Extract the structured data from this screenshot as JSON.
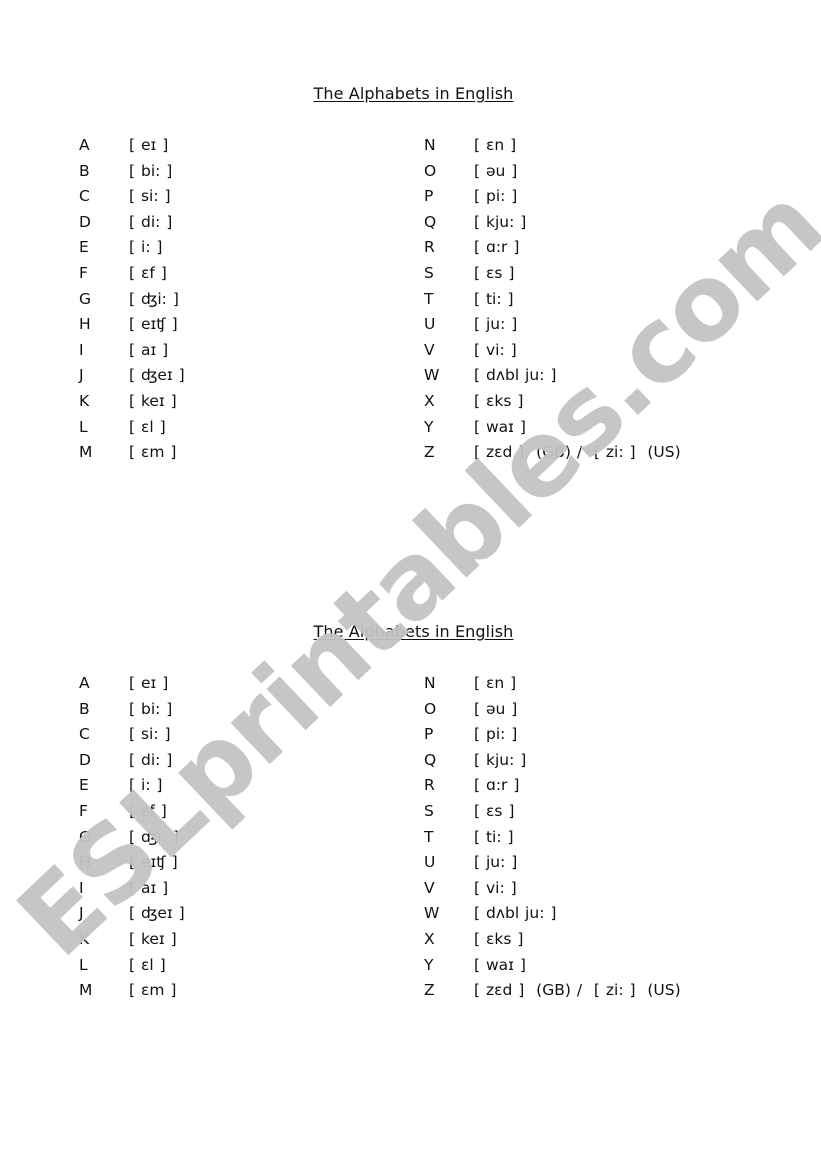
{
  "watermark": "ESLprintables.com",
  "blocks": [
    {
      "title": "The Alphabets in English",
      "left": [
        {
          "letter": "A",
          "ipa": "[ eɪ ]"
        },
        {
          "letter": "B",
          "ipa": "[ bi: ]"
        },
        {
          "letter": "C",
          "ipa": "[ si: ]"
        },
        {
          "letter": "D",
          "ipa": "[ di: ]"
        },
        {
          "letter": "E",
          "ipa": "[ i: ]"
        },
        {
          "letter": "F",
          "ipa": "[ ɛf ]"
        },
        {
          "letter": "G",
          "ipa": "[ ʤi: ]"
        },
        {
          "letter": "H",
          "ipa": "[ eɪʧ ]"
        },
        {
          "letter": "I",
          "ipa": "[ aɪ ]"
        },
        {
          "letter": "J",
          "ipa": "[ ʤeɪ ]"
        },
        {
          "letter": "K",
          "ipa": "[ keɪ ]"
        },
        {
          "letter": "L",
          "ipa": "[ ɛl ]"
        },
        {
          "letter": "M",
          "ipa": "[ ɛm ]"
        }
      ],
      "right": [
        {
          "letter": "N",
          "ipa": "[ ɛn ]"
        },
        {
          "letter": "O",
          "ipa": "[ əu ]"
        },
        {
          "letter": "P",
          "ipa": "[ pi: ]"
        },
        {
          "letter": "Q",
          "ipa": "[ kju: ]"
        },
        {
          "letter": "R",
          "ipa": "[ ɑ:r ]"
        },
        {
          "letter": "S",
          "ipa": "[ ɛs ]"
        },
        {
          "letter": "T",
          "ipa": "[ ti: ]"
        },
        {
          "letter": "U",
          "ipa": "[ ju: ]"
        },
        {
          "letter": "V",
          "ipa": "[ vi: ]"
        },
        {
          "letter": "W",
          "ipa": "[ dʌbl ju: ]"
        },
        {
          "letter": "X",
          "ipa": "[ ɛks ]"
        },
        {
          "letter": "Y",
          "ipa": "[ waɪ ]"
        },
        {
          "letter": "Z",
          "ipa": "[ zɛd ]  (GB) /  [ zi: ]  (US)"
        }
      ]
    },
    {
      "title": "The Alphabets in English",
      "left": [
        {
          "letter": "A",
          "ipa": "[ eɪ ]"
        },
        {
          "letter": "B",
          "ipa": "[ bi: ]"
        },
        {
          "letter": "C",
          "ipa": "[ si: ]"
        },
        {
          "letter": "D",
          "ipa": "[ di: ]"
        },
        {
          "letter": "E",
          "ipa": "[ i: ]"
        },
        {
          "letter": "F",
          "ipa": "[ ɛf ]"
        },
        {
          "letter": "G",
          "ipa": "[ ʤi: ]"
        },
        {
          "letter": "H",
          "ipa": "[ eɪʧ ]"
        },
        {
          "letter": "I",
          "ipa": "[ aɪ ]"
        },
        {
          "letter": "J",
          "ipa": "[ ʤeɪ ]"
        },
        {
          "letter": "K",
          "ipa": "[ keɪ ]"
        },
        {
          "letter": "L",
          "ipa": "[ ɛl ]"
        },
        {
          "letter": "M",
          "ipa": "[ ɛm ]"
        }
      ],
      "right": [
        {
          "letter": "N",
          "ipa": "[ ɛn ]"
        },
        {
          "letter": "O",
          "ipa": "[ əu ]"
        },
        {
          "letter": "P",
          "ipa": "[ pi: ]"
        },
        {
          "letter": "Q",
          "ipa": "[ kju: ]"
        },
        {
          "letter": "R",
          "ipa": "[ ɑ:r ]"
        },
        {
          "letter": "S",
          "ipa": "[ ɛs ]"
        },
        {
          "letter": "T",
          "ipa": "[ ti: ]"
        },
        {
          "letter": "U",
          "ipa": "[ ju: ]"
        },
        {
          "letter": "V",
          "ipa": "[ vi: ]"
        },
        {
          "letter": "W",
          "ipa": "[ dʌbl ju: ]"
        },
        {
          "letter": "X",
          "ipa": "[ ɛks ]"
        },
        {
          "letter": "Y",
          "ipa": "[ waɪ ]"
        },
        {
          "letter": "Z",
          "ipa": "[ zɛd ]  (GB) /  [ zi: ]  (US)"
        }
      ]
    }
  ]
}
